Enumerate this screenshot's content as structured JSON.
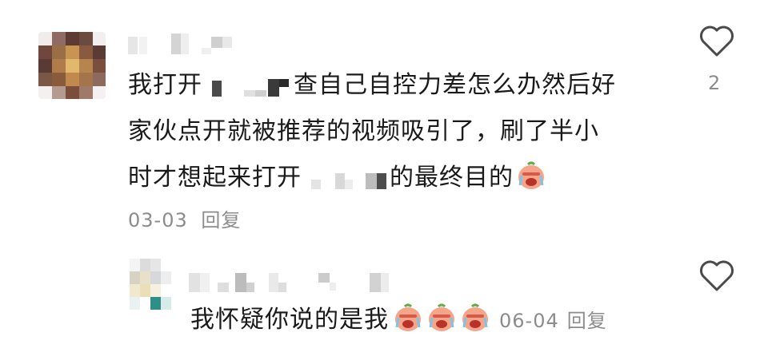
{
  "comment": {
    "text_part1": "我打开",
    "text_part2": "查自己自控力差怎么办然后好",
    "line2": "家伙点开就被推荐的视频吸引了，刷了半小",
    "line3_a": "时才想起来打开",
    "line3_b": "的最终目的",
    "emoji": "crying-face-emoji",
    "date": "03-03",
    "reply_label": "回复",
    "like_count": "2"
  },
  "reply": {
    "text": "我怀疑你说的是我",
    "emojis": [
      "crying-face-emoji",
      "crying-face-emoji",
      "crying-face-emoji"
    ],
    "date": "06-04",
    "reply_label": "回复"
  },
  "colors": {
    "text": "#1a1a1a",
    "meta": "#8c8c8c",
    "heart": "#4a4a4a"
  }
}
